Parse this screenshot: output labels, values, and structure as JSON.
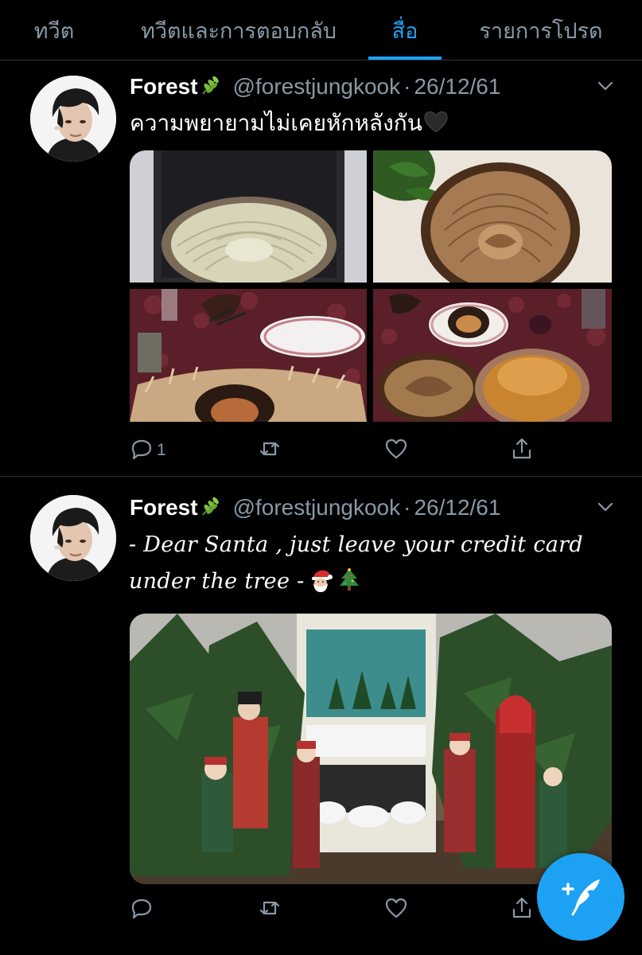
{
  "tabs": [
    {
      "label": "ทวีต",
      "active": false
    },
    {
      "label": "ทวีตและการตอบกลับ",
      "active": false
    },
    {
      "label": "สื่อ",
      "active": true
    },
    {
      "label": "รายการโปรด",
      "active": false
    }
  ],
  "tweets": [
    {
      "display_name": "Forest",
      "name_emoji": "herb",
      "handle": "@forestjungkook",
      "separator": "·",
      "date": "26/12/61",
      "text": "ความพยายามไม่เคยหักหลังกัน",
      "text_emoji": "black-heart",
      "media": [
        "apple-tart-raw-in-tin",
        "baked-apple-tart",
        "burnt-tart-on-table",
        "tarts-and-plates-on-table"
      ],
      "reply_count": "1"
    },
    {
      "display_name": "Forest",
      "name_emoji": "herb",
      "handle": "@forestjungkook",
      "separator": "·",
      "date": "26/12/61",
      "text": "- Dear Santa , just leave your credit card under the tree -",
      "text_emojis": [
        "santa",
        "christmas-tree"
      ],
      "media": [
        "christmas-carolers-figurines-and-trees"
      ],
      "reply_count": ""
    }
  ],
  "colors": {
    "accent": "#1da1f2",
    "secondary_text": "#8899a6",
    "divider": "#2f3336",
    "background": "#000000"
  },
  "icons": [
    "chevron-down-icon",
    "reply-icon",
    "retweet-icon",
    "like-icon",
    "share-icon",
    "compose-tweet-icon"
  ]
}
